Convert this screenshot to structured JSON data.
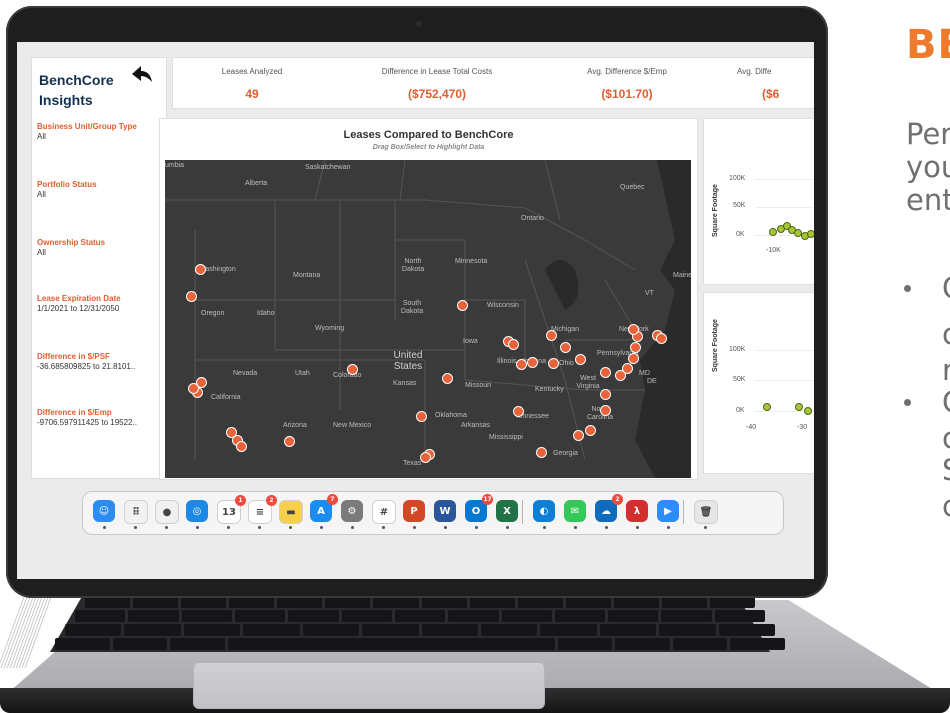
{
  "slide": {
    "title": "BE",
    "body_lines": [
      "Per",
      "you",
      "ent"
    ],
    "bullets": [
      {
        "lines": [
          "C",
          "c",
          "r"
        ]
      },
      {
        "lines": [
          "C",
          "c",
          "S",
          "c"
        ]
      }
    ]
  },
  "app": {
    "brand_line1": "BenchCore",
    "brand_line2": "Insights",
    "back_icon": "back-arrow-icon",
    "filters": [
      {
        "label": "Business Unit/Group Type",
        "value": "All"
      },
      {
        "label": "Portfolio Status",
        "value": "All"
      },
      {
        "label": "Ownership Status",
        "value": "All"
      },
      {
        "label": "Lease Expiration Date",
        "value": "1/1/2021 to 12/31/2050"
      },
      {
        "label": "Difference in $/PSF",
        "value": "-36.685809825 to 21.8101.."
      },
      {
        "label": "Difference in $/Emp",
        "value": "-9706.597911425 to 19522.."
      }
    ],
    "kpis": [
      {
        "label": "Leases Analyzed",
        "value": "49"
      },
      {
        "label": "Difference in Lease Total Costs",
        "value": "($752,470)"
      },
      {
        "label": "Avg. Difference $/Emp",
        "value": "($101.70)"
      },
      {
        "label": "Avg. Diffe",
        "value": "($6"
      }
    ],
    "map": {
      "title": "Leases Compared to BenchCore",
      "subtitle": "Drag Box/Select to Highlight Data",
      "labels": {
        "umbia": "umbia",
        "saskatchewan": "Saskatchewan",
        "alberta": "Alberta",
        "quebec": "Quebec",
        "ontario": "Ontario",
        "washington": "Washington",
        "montana": "Montana",
        "north_dakota": "North Dakota",
        "minnesota": "Minnesota",
        "maine": "Maine",
        "oregon": "Oregon",
        "idaho": "Idaho",
        "south_dakota": "South Dakota",
        "wisconsin": "Wisconsin",
        "vt": "VT",
        "wyoming": "Wyoming",
        "michigan": "Michigan",
        "new_york": "New York",
        "iowa": "Iowa",
        "united_states": "United States",
        "nevada": "Nevada",
        "utah": "Utah",
        "colorado": "Colorado",
        "illinois": "Illinois",
        "indiana": "Indiana",
        "ohio": "Ohio",
        "pennsylvania": "Pennsylvania",
        "kansas": "Kansas",
        "missouri": "Missouri",
        "west_virginia": "West Virginia",
        "md": "MD",
        "de": "DE",
        "california": "California",
        "kentucky": "Kentucky",
        "oklahoma": "Oklahoma",
        "tennessee": "Tennessee",
        "north_carolina": "North Carolina",
        "arizona": "Arizona",
        "new_mexico": "New Mexico",
        "arkansas": "Arkansas",
        "mississippi": "Mississippi",
        "georgia": "Georgia",
        "texas": "Texas"
      }
    },
    "scatter1": {
      "ylabel": "Square Footage",
      "yticks": [
        "100K",
        "50K",
        "0K"
      ],
      "xticks": [
        "-10K"
      ]
    },
    "scatter2": {
      "ylabel": "Square Footage",
      "yticks": [
        "100K",
        "50K",
        "0K"
      ],
      "xticks": [
        "-40",
        "-30"
      ]
    }
  },
  "dock": {
    "items": [
      {
        "name": "finder-icon",
        "glyph": "☺",
        "color": "#2d8cf0",
        "badge": ""
      },
      {
        "name": "launchpad-icon",
        "glyph": "⠿",
        "color": "#f2f2f2",
        "badge": ""
      },
      {
        "name": "chrome-icon",
        "glyph": "●",
        "color": "#f0f0f0",
        "badge": ""
      },
      {
        "name": "safari-icon",
        "glyph": "◎",
        "color": "#1e88e5",
        "badge": ""
      },
      {
        "name": "calendar-icon",
        "glyph": "13",
        "color": "#ffffff",
        "badge": "1"
      },
      {
        "name": "reminders-icon",
        "glyph": "≡",
        "color": "#ffffff",
        "badge": "2"
      },
      {
        "name": "notes-icon",
        "glyph": "▬",
        "color": "#f6d04d",
        "badge": ""
      },
      {
        "name": "app-store-icon",
        "glyph": "A",
        "color": "#1c8df0",
        "badge": "7"
      },
      {
        "name": "system-preferences-icon",
        "glyph": "⚙",
        "color": "#7a7a7a",
        "badge": ""
      },
      {
        "name": "slack-icon",
        "glyph": "#",
        "color": "#ffffff",
        "badge": ""
      },
      {
        "name": "powerpoint-icon",
        "glyph": "P",
        "color": "#d24726",
        "badge": ""
      },
      {
        "name": "word-icon",
        "glyph": "W",
        "color": "#2b579a",
        "badge": ""
      },
      {
        "name": "outlook-icon",
        "glyph": "O",
        "color": "#0078d4",
        "badge": "17"
      },
      {
        "name": "excel-icon",
        "glyph": "X",
        "color": "#217346",
        "badge": ""
      },
      {
        "name": "edge-icon",
        "glyph": "◐",
        "color": "#0f7fd6",
        "badge": ""
      },
      {
        "name": "messages-icon",
        "glyph": "✉",
        "color": "#34c759",
        "badge": ""
      },
      {
        "name": "onedrive-icon",
        "glyph": "☁",
        "color": "#0f6cbd",
        "badge": "2"
      },
      {
        "name": "acrobat-icon",
        "glyph": "λ",
        "color": "#d32f2f",
        "badge": ""
      },
      {
        "name": "zoom-icon",
        "glyph": "▶",
        "color": "#2d8cff",
        "badge": ""
      },
      {
        "name": "trash-icon",
        "glyph": "🗑",
        "color": "#e6e6e6",
        "badge": ""
      }
    ]
  },
  "colors": {
    "accent": "#e05d30",
    "slide_title": "#ee7a2e",
    "brand": "#13314f",
    "pin": "#e8623a",
    "scatter_dot": "#a9c436"
  }
}
